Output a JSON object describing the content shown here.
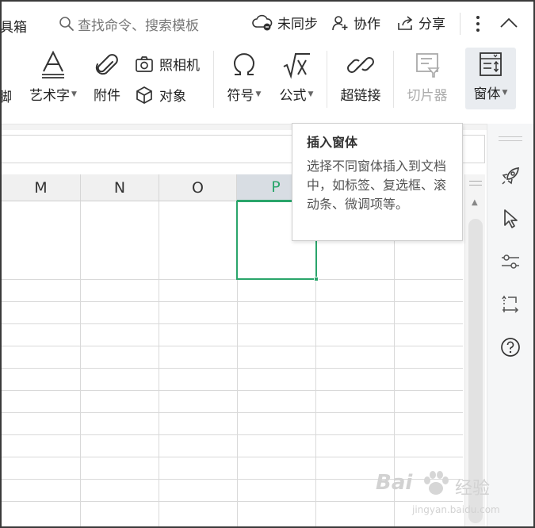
{
  "topbar": {
    "partial_title": "具箱",
    "search_placeholder": "查找命令、搜索模板",
    "sync_label": "未同步",
    "collab_label": "协作",
    "share_label": "分享"
  },
  "ribbon": {
    "partial_label": "脚",
    "wordart_label": "艺术字",
    "attachment_label": "附件",
    "camera_label": "照相机",
    "object_label": "对象",
    "symbol_label": "符号",
    "formula_label": "公式",
    "hyperlink_label": "超链接",
    "slicer_label": "切片器",
    "form_label": "窗体"
  },
  "sheet": {
    "columns": [
      "M",
      "N",
      "O",
      "P"
    ],
    "selected_column": "P"
  },
  "tooltip": {
    "title": "插入窗体",
    "body": "选择不同窗体插入到文档中，如标签、复选框、滚动条、微调项等。"
  },
  "sidepanel": {
    "icons": [
      "rocket-icon",
      "cursor-icon",
      "sliders-icon",
      "transform-icon",
      "help-icon"
    ]
  },
  "watermark": {
    "brand": "Bai",
    "brand_suffix": "经验",
    "url": "jingyan.baidu.com"
  },
  "colors": {
    "accent_green": "#2aa56b",
    "selected_header_bg": "#d8dde3",
    "ribbon_active_bg": "#e9ecf0"
  }
}
